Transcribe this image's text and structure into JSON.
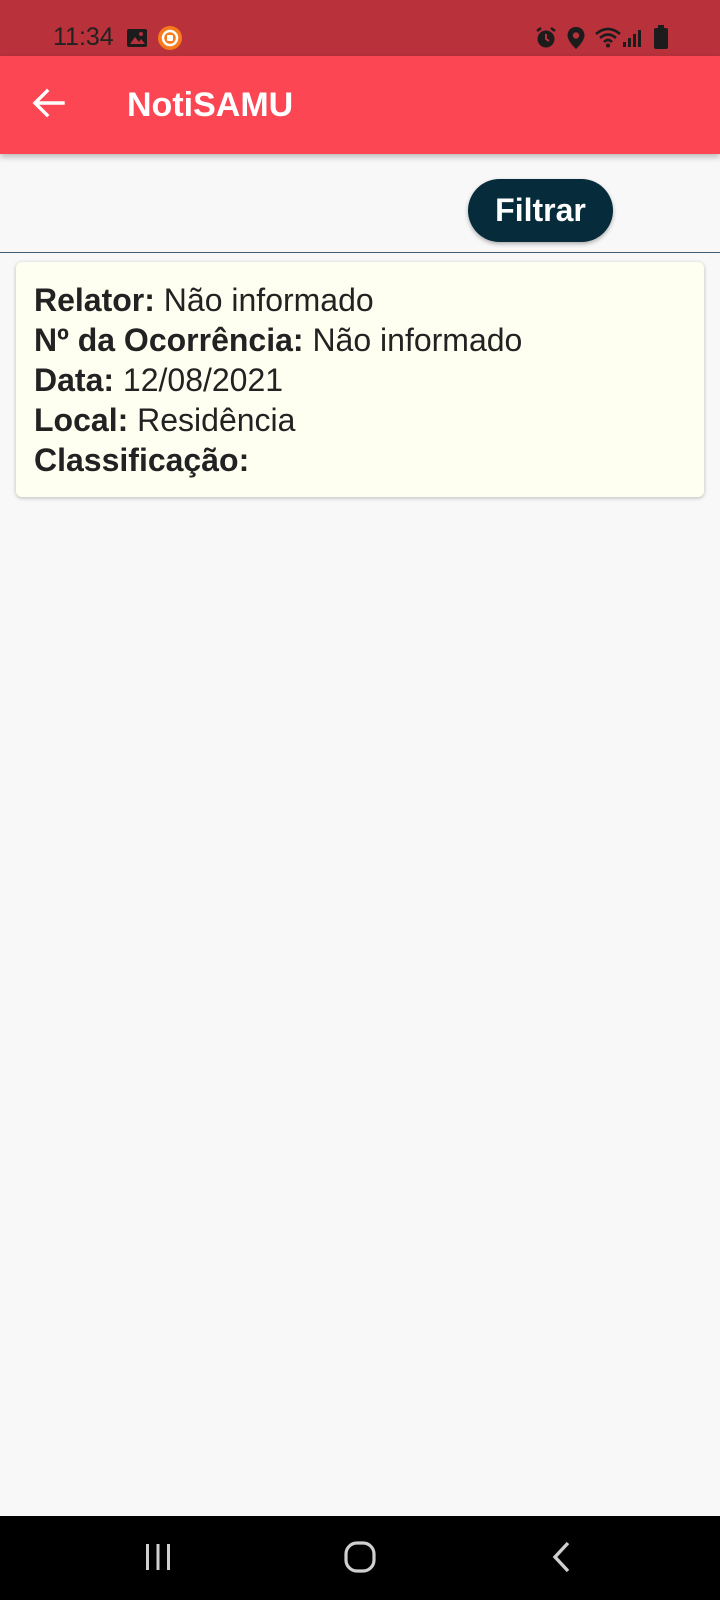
{
  "status_bar": {
    "time": "11:34",
    "icons": [
      "gallery-icon",
      "app-notification-icon",
      "alarm-icon",
      "location-icon",
      "wifi-icon",
      "signal-icon",
      "battery-icon"
    ]
  },
  "app_bar": {
    "title": "NotiSAMU",
    "back_icon": "arrow-left-icon"
  },
  "filter": {
    "label": "Filtrar"
  },
  "occurrences": [
    {
      "relator_label": "Relator:",
      "relator_value": "Não informado",
      "numero_label": "Nº da Ocorrência:",
      "numero_value": "Não informado",
      "data_label": "Data:",
      "data_value": "12/08/2021",
      "local_label": "Local:",
      "local_value": "Residência",
      "classificacao_label": "Classificação:",
      "classificacao_value": ""
    }
  ],
  "nav_bar": {
    "icons": [
      "recent-apps-icon",
      "home-icon",
      "back-icon"
    ]
  },
  "colors": {
    "status_bar": "#b8313b",
    "app_bar": "#fc4654",
    "filter_button": "#062b3a",
    "card_background": "#fefff0",
    "page_background": "#f8f8f9"
  }
}
